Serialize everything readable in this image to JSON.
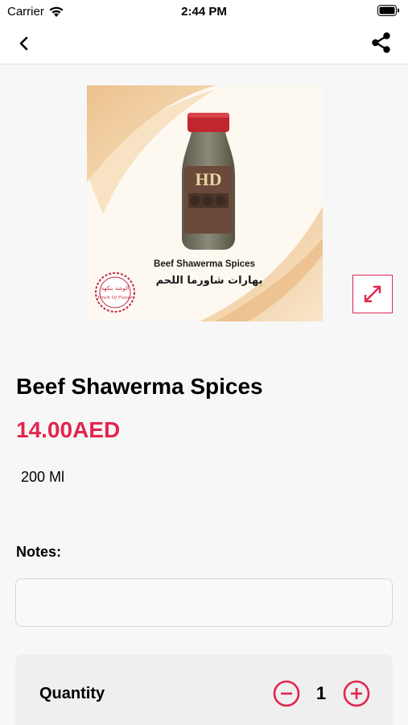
{
  "status_bar": {
    "carrier": "Carrier",
    "time": "2:44 PM"
  },
  "nav": {
    "back_icon": "chevron-left-icon",
    "share_icon": "share-icon"
  },
  "product": {
    "image": {
      "english_label": "Beef Shawerma Spices",
      "arabic_label": "بهارات شاورما اللحم",
      "brand_mark": "HD",
      "stamp_arabic": "الوشة بنكهة",
      "stamp_english": "Pinch Of Flavor"
    },
    "title": "Beef Shawerma Spices",
    "price": "14.00AED",
    "size": "200 Ml"
  },
  "notes": {
    "label": "Notes:",
    "value": "",
    "placeholder": ""
  },
  "quantity": {
    "label": "Quantity",
    "value": "1"
  },
  "colors": {
    "accent": "#e2264f",
    "background": "#f7f7f7"
  }
}
